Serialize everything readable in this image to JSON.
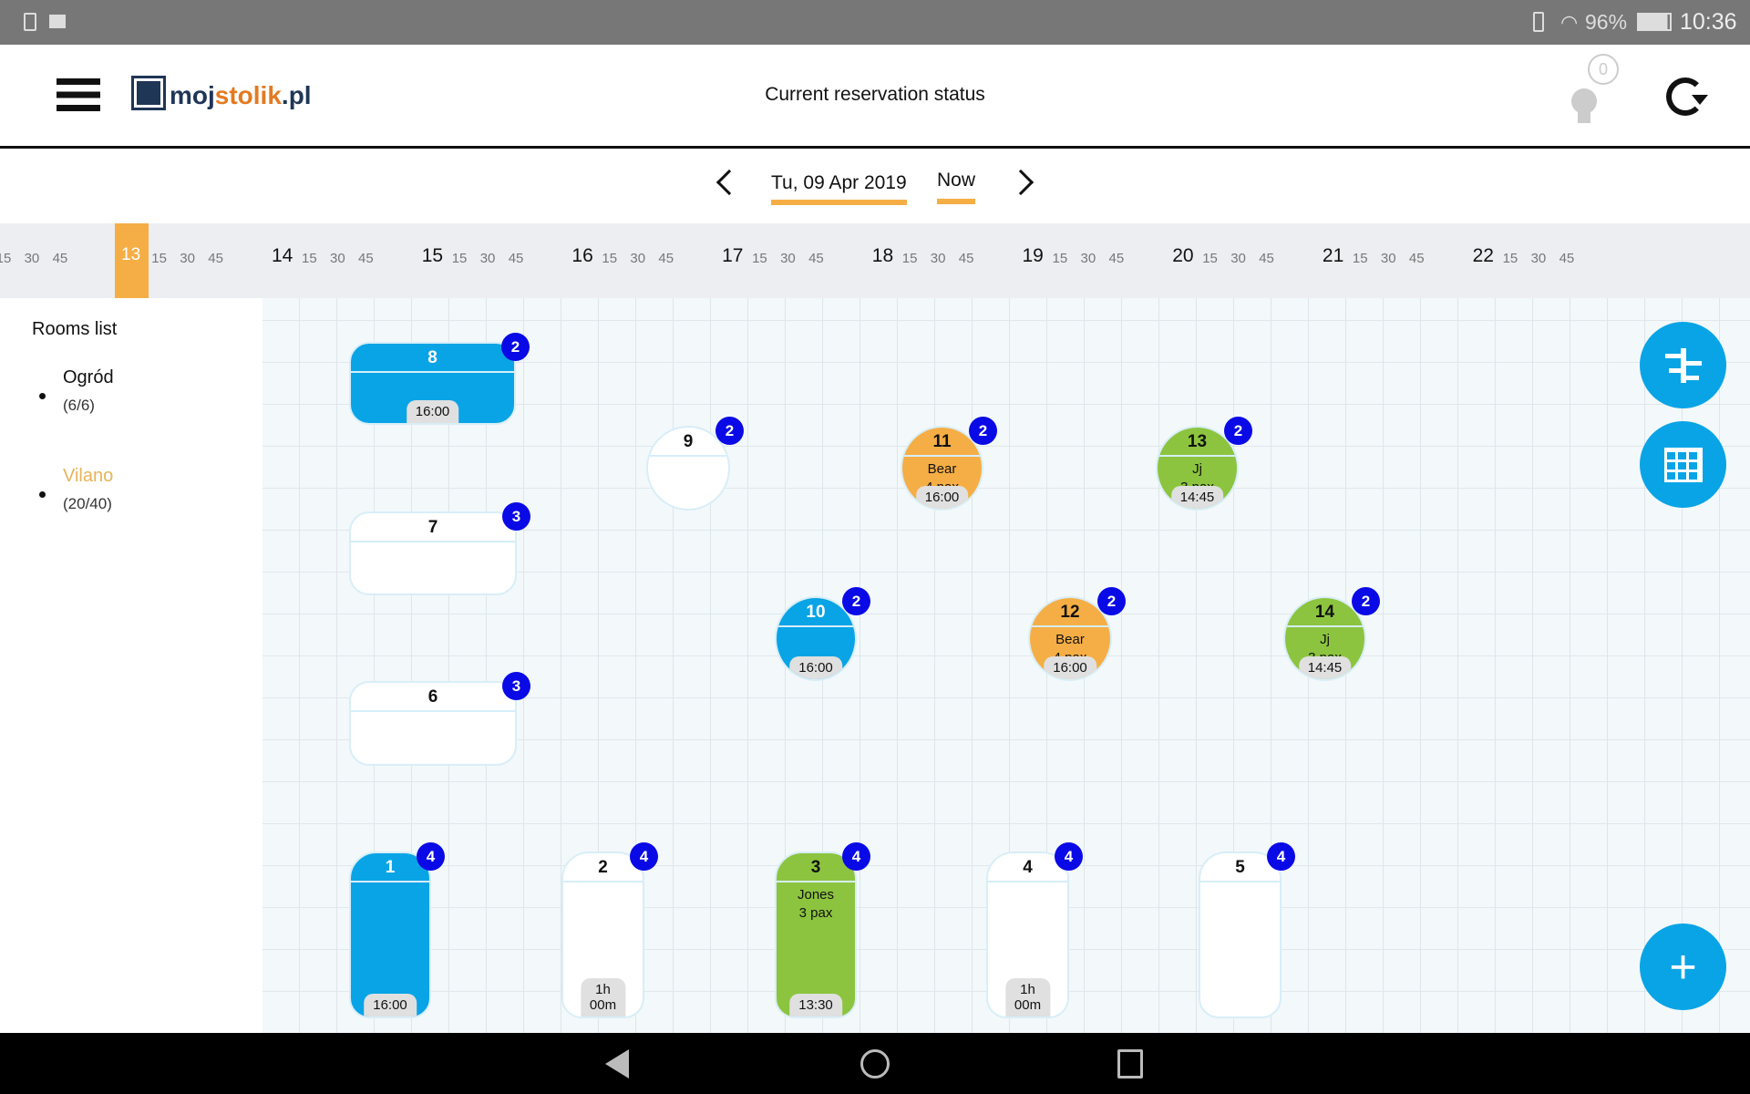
{
  "status_bar": {
    "battery": "96%",
    "time": "10:36"
  },
  "header": {
    "logo_part1": "moj",
    "logo_part2": "stolik",
    "logo_part3": ".pl",
    "title": "Current reservation status",
    "notifications_count": "0"
  },
  "date_nav": {
    "date": "Tu, 09 Apr 2019",
    "now_label": "Now"
  },
  "timeline": {
    "current_hour": "13",
    "hours": [
      "14",
      "15",
      "16",
      "17",
      "18",
      "19",
      "20",
      "21",
      "22"
    ],
    "quarters": [
      "15",
      "30",
      "45"
    ]
  },
  "sidebar": {
    "title": "Rooms list",
    "rooms": [
      {
        "name": "Ogród",
        "count": "(6/6)"
      },
      {
        "name": "Vilano",
        "count": "(20/40)",
        "active": true
      }
    ]
  },
  "colors": {
    "accent": "#f5ae45",
    "reserved_blue": "#08a4e6",
    "arrived_green": "#8cc43f",
    "seated_orange": "#f5ae45",
    "badge": "#0a0ae6"
  },
  "tables": [
    {
      "number": "8",
      "seats": "2",
      "status": "blue",
      "time": "16:00"
    },
    {
      "number": "7",
      "seats": "3",
      "status": "free"
    },
    {
      "number": "6",
      "seats": "3",
      "status": "free"
    },
    {
      "number": "9",
      "seats": "2",
      "status": "free"
    },
    {
      "number": "11",
      "seats": "2",
      "status": "orange",
      "guest": "Bear",
      "pax": "4  pax",
      "time": "16:00"
    },
    {
      "number": "13",
      "seats": "2",
      "status": "green",
      "guest": "Jj",
      "pax": "3  pax",
      "time": "14:45"
    },
    {
      "number": "10",
      "seats": "2",
      "status": "blue",
      "time": "16:00"
    },
    {
      "number": "12",
      "seats": "2",
      "status": "orange",
      "guest": "Bear",
      "pax": "4  pax",
      "time": "16:00"
    },
    {
      "number": "14",
      "seats": "2",
      "status": "green",
      "guest": "Jj",
      "pax": "3  pax",
      "time": "14:45"
    },
    {
      "number": "1",
      "seats": "4",
      "status": "blue",
      "time": "16:00"
    },
    {
      "number": "2",
      "seats": "4",
      "status": "free",
      "time": "1h 00m"
    },
    {
      "number": "3",
      "seats": "4",
      "status": "green",
      "guest": "Jones",
      "pax": "3  pax",
      "time": "13:30"
    },
    {
      "number": "4",
      "seats": "4",
      "status": "free",
      "time": "1h 00m"
    },
    {
      "number": "5",
      "seats": "4",
      "status": "free"
    }
  ]
}
